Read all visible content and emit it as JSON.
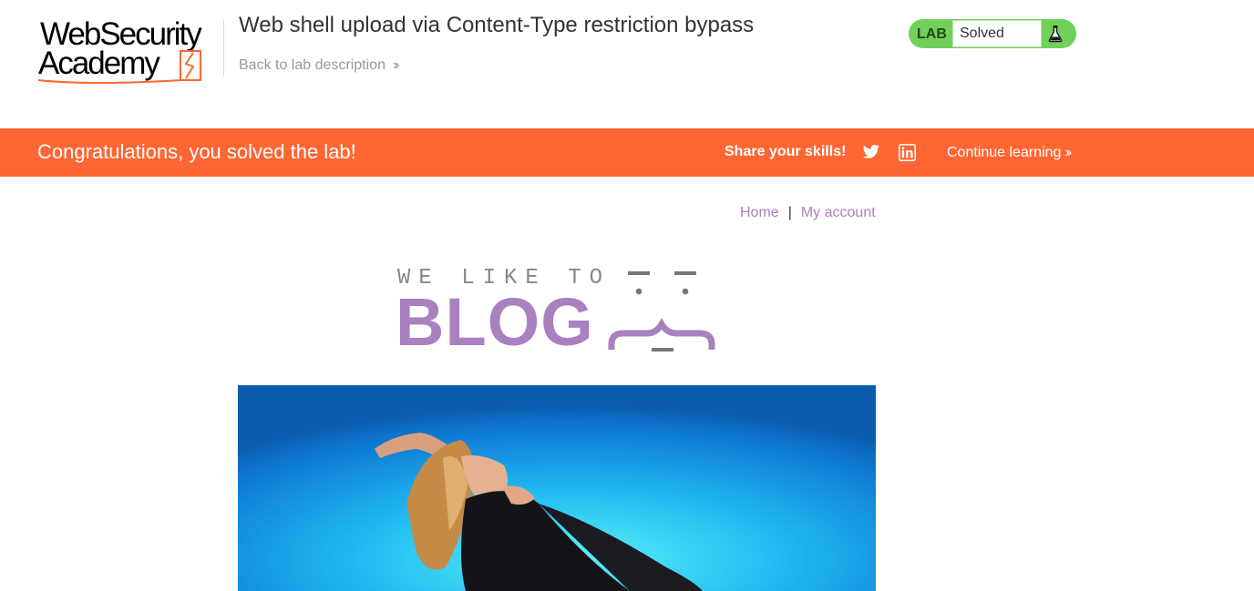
{
  "header": {
    "logo_line1": "WebSecurity",
    "logo_line2": "Academy",
    "lab_title": "Web shell upload via Content-Type restriction bypass",
    "back_link": "Back to lab description"
  },
  "status": {
    "label": "LAB",
    "value": "Solved",
    "icon": "flask-icon"
  },
  "banner": {
    "message": "Congratulations, you solved the lab!",
    "share_text": "Share your skills!",
    "share_icons": [
      "twitter-icon",
      "linkedin-icon"
    ],
    "continue_link": "Continue learning"
  },
  "nav": {
    "home": "Home",
    "separator": "|",
    "account": "My account"
  },
  "blog": {
    "tagline": "WE LIKE TO",
    "wordmark": "BLOG"
  },
  "colors": {
    "banner": "#ff6633",
    "accent": "#a980c0",
    "status_green": "#70d05a"
  }
}
